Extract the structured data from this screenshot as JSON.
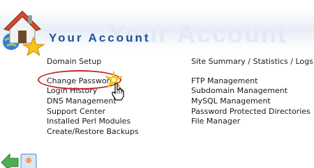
{
  "header": {
    "title": "Your Account",
    "ghost_title": "Your Account"
  },
  "left_links": [
    "Domain Setup",
    "Change Password",
    "Login History",
    "DNS Management",
    "Support Center",
    "Installed Perl Modules",
    "Create/Restore Backups"
  ],
  "right_links": [
    "Site Summary / Statistics / Logs",
    "FTP Management",
    "Subdomain Management",
    "MySQL Management",
    "Password Protected Directories",
    "File Manager"
  ],
  "colors": {
    "title": "#1f4f9a",
    "highlight": "#c4262b",
    "ghost": "#e3eaf4"
  },
  "icons": [
    "house-icon",
    "star-icon",
    "globe-icon",
    "sparkle-icon",
    "cursor-icon",
    "bottom-section-icon"
  ]
}
